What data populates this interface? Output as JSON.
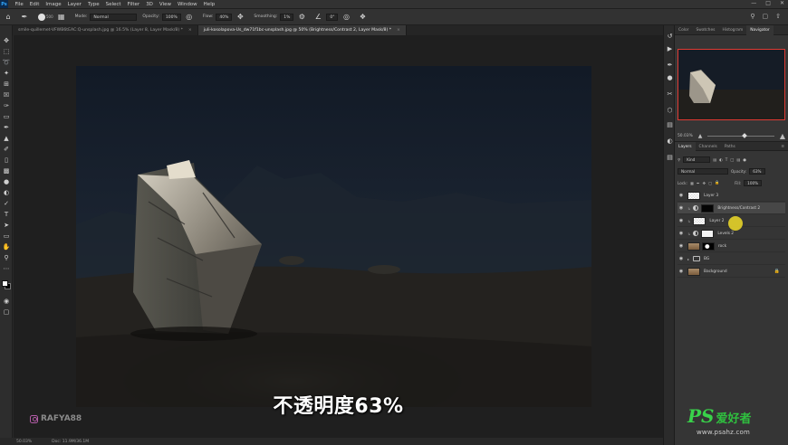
{
  "menubar": {
    "logo": "Ps",
    "items": [
      "File",
      "Edit",
      "Image",
      "Layer",
      "Type",
      "Select",
      "Filter",
      "3D",
      "View",
      "Window",
      "Help"
    ]
  },
  "options": {
    "brush_size": "500",
    "mode_label": "Mode:",
    "mode_value": "Normal",
    "opacity_label": "Opacity:",
    "opacity_value": "100%",
    "flow_label": "Flow:",
    "flow_value": "40%",
    "smoothing_label": "Smoothing:",
    "smoothing_value": "1%",
    "angle_value": "0°"
  },
  "tabs": [
    {
      "label": "smile-quillemet-VFWB6tEAC:Q-unsplash.jpg @ 16.5% (Layer 8, Layer Mask/8) *",
      "close": "×"
    },
    {
      "label": "juli-kosolapova-Us_dw71f1bc-unsplash.jpg @ 50% (Brightness/Contrast 2, Layer Mask/8) *",
      "close": "×"
    }
  ],
  "canvas": {
    "subtitle": "不透明度63%",
    "watermark_handle": "RAFYA88"
  },
  "status": {
    "zoom": "50.03%",
    "doc": "Doc: 11.9M/36.1M"
  },
  "navigator": {
    "tabs": [
      "Color",
      "Swatches",
      "Histogram",
      "Navigator"
    ],
    "zoom": "50.03%",
    "zoom_level": 0.52
  },
  "layers_panel": {
    "tabs": [
      "Layers",
      "Channels",
      "Paths"
    ],
    "filter_label": "Kind",
    "blend_mode": "Normal",
    "opacity_label": "Opacity:",
    "opacity_value": "63%",
    "lock_label": "Lock:",
    "fill_label": "Fill:",
    "fill_value": "100%",
    "layers": [
      {
        "name": "Layer 3",
        "thumb": "trans"
      },
      {
        "name": "Brightness/Contrast 2",
        "thumb": "black",
        "adj": true,
        "selected": true
      },
      {
        "name": "Layer 2",
        "thumb": "trans"
      },
      {
        "name": "Levels 2",
        "thumb": "white",
        "adj": true
      },
      {
        "name": "rock",
        "thumb": "mask"
      },
      {
        "name": "BG",
        "folder": true
      },
      {
        "name": "Background",
        "thumb": "photo",
        "locked": true
      }
    ]
  },
  "site_watermark": {
    "ps": "PS",
    "cn": "爱好者",
    "url": "www.psahz.com"
  },
  "colors": {
    "accent_nav_box": "#e03a33",
    "highlight_cursor": "#f0dc28",
    "watermark_green": "#39d24a"
  }
}
